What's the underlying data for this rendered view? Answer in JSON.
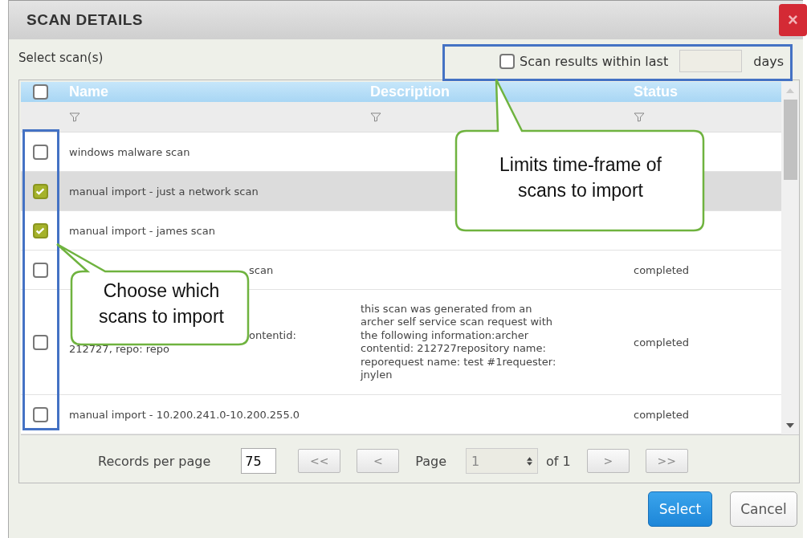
{
  "window": {
    "title": "SCAN DETAILS",
    "close": "×"
  },
  "select_label": "Select scan(s)",
  "time_filter": {
    "checked": false,
    "label": "Scan results within last",
    "unit": "days"
  },
  "table": {
    "all_checked": false,
    "columns": [
      {
        "label": "Name"
      },
      {
        "label": "Description"
      },
      {
        "label": "Status"
      }
    ],
    "rows": [
      {
        "checked": false,
        "selected": false,
        "name": [
          "windows malware scan"
        ],
        "description": []
      },
      {
        "checked": true,
        "selected": true,
        "name": [
          "manual import - just a network scan"
        ],
        "description": []
      },
      {
        "checked": true,
        "selected": false,
        "name": [
          "manual import - james scan"
        ],
        "description": []
      },
      {
        "checked": false,
        "selected": false,
        "name": [
          "scan"
        ],
        "description": [],
        "status": "completed"
      },
      {
        "checked": false,
        "selected": false,
        "name": [
          "ontentid:",
          "212727, repo: repo"
        ],
        "description": [
          "this scan was generated from an",
          "archer self service scan request with",
          "the following information:archer",
          "contentid: 212727repository name:",
          "reporequest name: test #1requester:",
          "jnylen"
        ],
        "status": "completed"
      },
      {
        "checked": false,
        "selected": false,
        "name": [
          "manual import - 10.200.241.0-10.200.255.0"
        ],
        "description": [],
        "status": "completed"
      }
    ]
  },
  "pagination": {
    "records_label": "Records per page",
    "records": "75",
    "first": "<<",
    "prev": "<",
    "page_label": "Page",
    "page": "1",
    "of": "of 1",
    "next": ">",
    "last": ">>"
  },
  "buttons": [
    {
      "label": "Select",
      "kind": "primary"
    },
    {
      "label": "Cancel",
      "kind": "secondary"
    }
  ],
  "callouts": [
    {
      "text": [
        "Limits time-frame of",
        "scans to import"
      ],
      "kind": "up"
    },
    {
      "text": [
        "Choose which",
        "scans to import"
      ],
      "kind": "left"
    }
  ]
}
